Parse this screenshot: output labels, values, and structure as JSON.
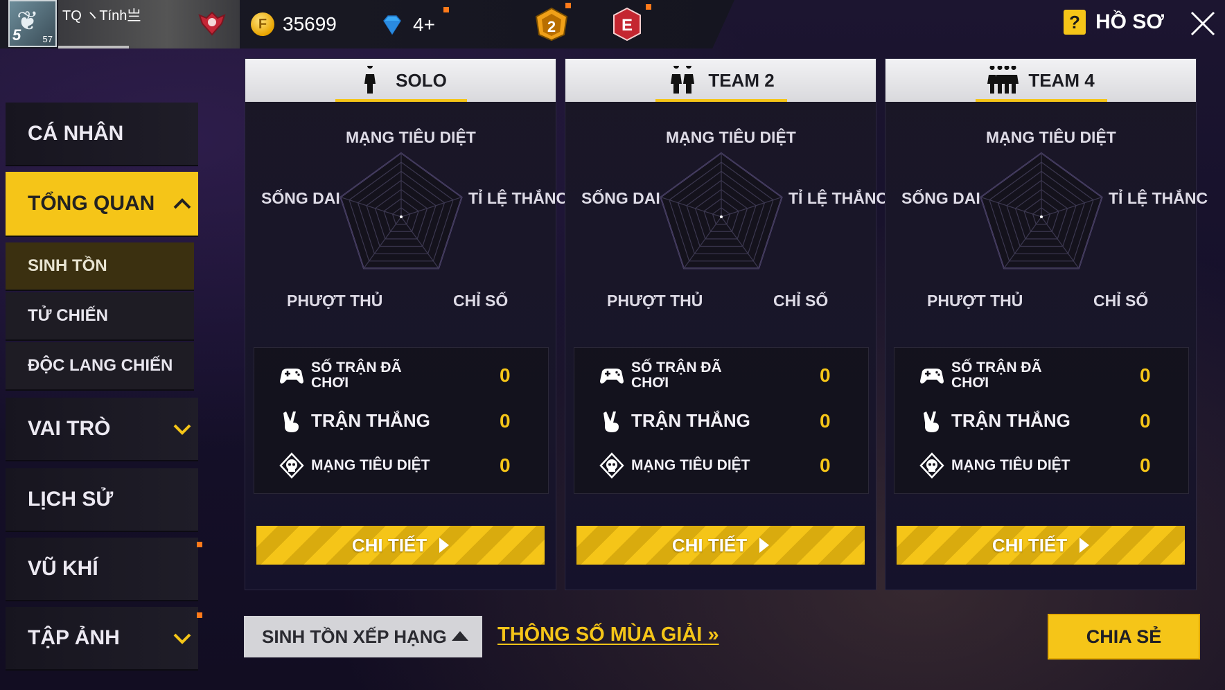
{
  "topbar": {
    "player_name": "TQ ヽTính亗",
    "level_badge": "5",
    "level_small": "57",
    "gold": "35699",
    "diamonds": "4+",
    "rank_badge_number": "2",
    "rank_badge_letter": "E",
    "profile_label": "HỒ SƠ",
    "help_icon_glyph": "?"
  },
  "sidebar": {
    "items": [
      {
        "label": "CÁ NHÂN"
      },
      {
        "label": "TỔNG QUAN"
      },
      {
        "label": "VAI TRÒ"
      },
      {
        "label": "LỊCH SỬ"
      },
      {
        "label": "VŨ KHÍ"
      },
      {
        "label": "TẬP ẢNH"
      }
    ],
    "sub_items": [
      {
        "label": "SINH TỒN"
      },
      {
        "label": "TỬ CHIẾN"
      },
      {
        "label": "ĐỘC LANG CHIẾN"
      }
    ]
  },
  "radar_labels": {
    "top": "MẠNG TIÊU DIỆT",
    "left": "SỐNG DAI",
    "right": "TỈ LỆ THẮNC",
    "bottom_left": "PHƯỢT THỦ",
    "bottom_right": "CHỈ SỐ"
  },
  "stat_labels": {
    "matches_line1": "SỐ TRẬN ĐÃ",
    "matches_line2": "CHƠI",
    "wins": "TRẬN THẮNG",
    "kills": "MẠNG TIÊU DIỆT"
  },
  "panels": [
    {
      "title": "SOLO",
      "matches": "0",
      "wins": "0",
      "kills": "0",
      "button": "CHI TIẾT"
    },
    {
      "title": "TEAM 2",
      "matches": "0",
      "wins": "0",
      "kills": "0",
      "button": "CHI TIẾT"
    },
    {
      "title": "TEAM 4",
      "matches": "0",
      "wins": "0",
      "kills": "0",
      "button": "CHI TIẾT"
    }
  ],
  "bottom": {
    "mode_select": "SINH TỒN XẾP HẠNG",
    "season_link": "THÔNG SỐ MÙA GIẢI",
    "share_button": "CHIA SẺ"
  },
  "colors": {
    "accent": "#f5c518",
    "notification": "#ff7a1a",
    "background": "#1a1530"
  }
}
